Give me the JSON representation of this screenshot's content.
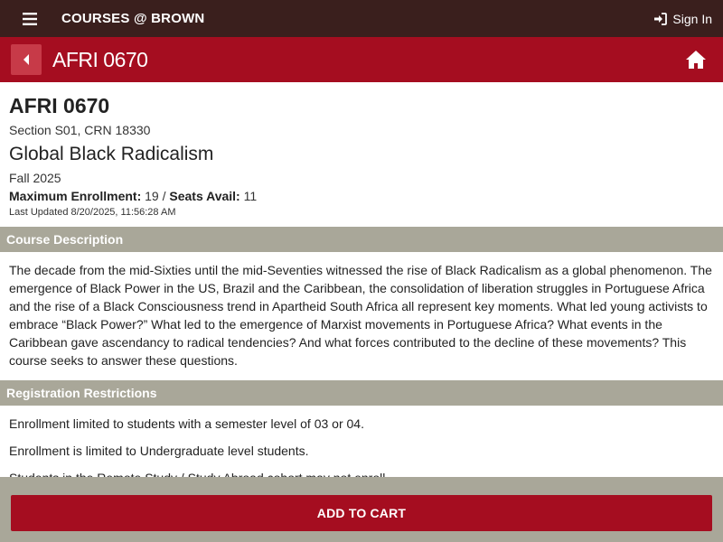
{
  "topbar": {
    "brand": "COURSES @ BROWN",
    "signin_label": "Sign In"
  },
  "header": {
    "title": "AFRI 0670"
  },
  "course": {
    "code": "AFRI 0670",
    "section": "Section S01, CRN 18330",
    "title": "Global Black Radicalism",
    "term": "Fall 2025",
    "max_enrollment_label": "Maximum Enrollment:",
    "max_enrollment_value": "19",
    "separator": "/",
    "seats_avail_label": "Seats Avail:",
    "seats_avail_value": "11",
    "last_updated": "Last Updated 8/20/2025, 11:56:28 AM"
  },
  "description": {
    "heading": "Course Description",
    "text": "The decade from the mid-Sixties until the mid-Seventies witnessed the rise of Black Radicalism as a global phenomenon. The emergence of Black Power in the US, Brazil and the Caribbean, the consolidation of liberation struggles in Portuguese Africa and the rise of a Black Consciousness trend in Apartheid South Africa all represent key moments. What led young activists to embrace “Black Power?” What led to the emergence of Marxist movements in Portuguese Africa? What events in the Caribbean gave ascendancy to radical tendencies? And what forces contributed to the decline of these movements? This course seeks to answer these questions."
  },
  "restrictions": {
    "heading": "Registration Restrictions",
    "items": [
      "Enrollment limited to students with a semester level of 03 or 04.",
      "Enrollment is limited to Undergraduate level students.",
      "Students in the Remote Study / Study Abroad cohort may not enroll."
    ]
  },
  "footer": {
    "add_to_cart_label": "ADD TO CART"
  },
  "colors": {
    "topbar": "#3a1f1d",
    "header": "#a50d20",
    "band": "#a9a799",
    "button": "#a50d20"
  },
  "icons": {
    "menu": "hamburger-icon",
    "signin": "sign-in-icon",
    "back": "caret-left-icon",
    "home": "home-icon"
  }
}
